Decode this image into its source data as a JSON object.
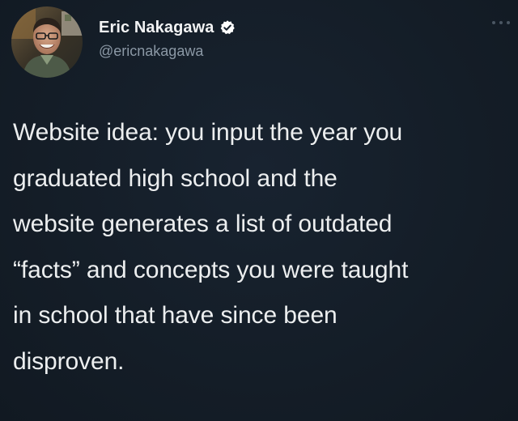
{
  "author": {
    "display_name": "Eric Nakagawa",
    "handle": "@ericnakagawa",
    "verified": true,
    "avatar_icon": "profile-photo",
    "verified_icon": "verified-badge-icon"
  },
  "menu": {
    "icon": "more-options-icon"
  },
  "tweet": {
    "lines": [
      "Website idea: you input the year you",
      "graduated high school and the",
      "website generates a list of outdated",
      "“facts” and concepts you were taught",
      "in school that have since been",
      "disproven."
    ]
  },
  "colors": {
    "background": "#16202b",
    "text": "#e7e9ea",
    "handle": "#8b98a5",
    "verified_badge": "#ffffff"
  }
}
